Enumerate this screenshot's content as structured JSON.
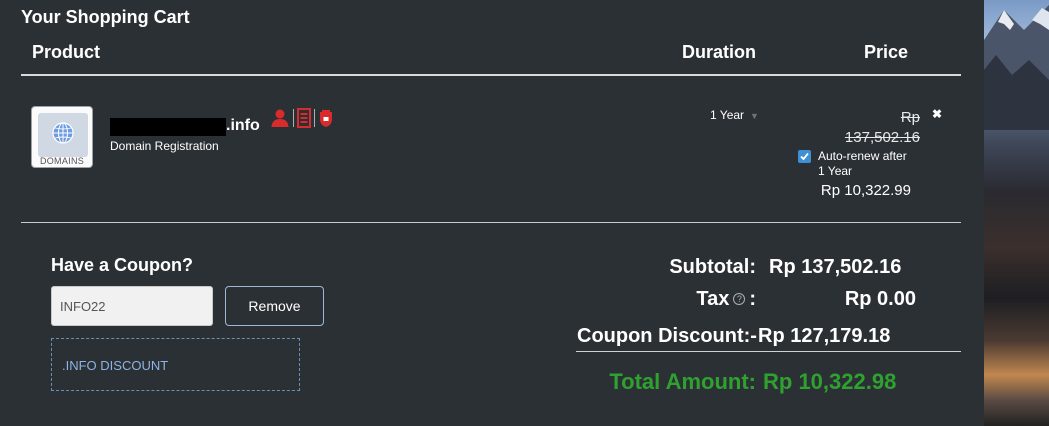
{
  "cart": {
    "title": "Your Shopping Cart",
    "headers": {
      "product": "Product",
      "duration": "Duration",
      "price": "Price"
    }
  },
  "item": {
    "tile_label": "DOMAINS",
    "domain_suffix": ".info",
    "description": "Domain Registration",
    "duration": "1 Year",
    "price_old_line1": "Rp",
    "price_old_line2": "137,502.16",
    "autorenew_label": "Auto-renew after 1 Year",
    "autorenew_checked": true,
    "price_new": "Rp 10,322.99",
    "remove_glyph": "✖",
    "badge_icons": [
      "user-icon",
      "list-icon",
      "shield-icon"
    ]
  },
  "coupon": {
    "title": "Have a Coupon?",
    "code": "INFO22",
    "remove_label": "Remove",
    "applied_note": ".INFO DISCOUNT"
  },
  "totals": {
    "subtotal_label": "Subtotal:",
    "subtotal_value": "Rp 137,502.16",
    "tax_label": "Tax",
    "tax_colon": ":",
    "tax_value": "Rp 0.00",
    "discount_label": "Coupon Discount:-",
    "discount_value": "Rp 127,179.18",
    "total_label": "Total Amount:",
    "total_value": "Rp 10,322.98"
  },
  "colors": {
    "background": "#2b3035",
    "total_green": "#2fa12f",
    "badge_red": "#d92b2b",
    "checkbox_blue": "#3d8fd6",
    "coupon_note_blue": "#8db4e2"
  }
}
